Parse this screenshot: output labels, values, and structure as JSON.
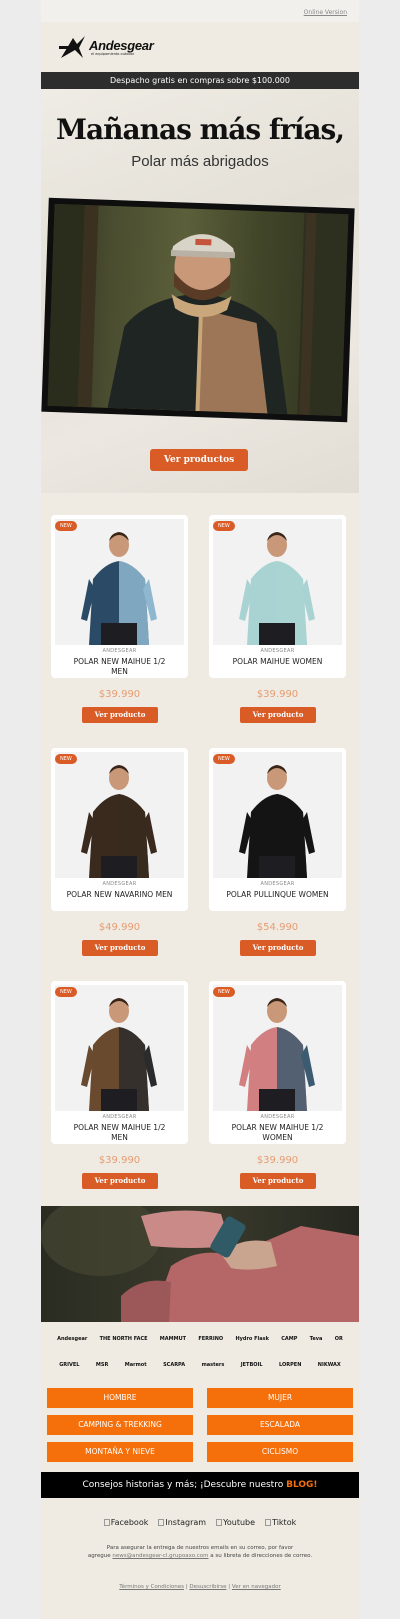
{
  "topbar": {
    "online_version": "Online Version"
  },
  "logo": {
    "name": "Andesgear",
    "tagline": "el equipamiento outdoor"
  },
  "shipping_banner": "Despacho gratis en compras sobre $100.000",
  "hero": {
    "title": "Mañanas más frías,",
    "subtitle": "Polar más abrigados",
    "cta": "Ver productos"
  },
  "products": [
    {
      "badge": "NEW",
      "brand": "ANDESGEAR",
      "name": "POLAR NEW MAIHUE 1/2 MEN",
      "price": "$39.990",
      "button": "Ver producto",
      "colors": {
        "body": "#2b4a66",
        "accent": "#8fb7d0"
      }
    },
    {
      "badge": "NEW",
      "brand": "ANDESGEAR",
      "name": "POLAR MAIHUE WOMEN",
      "price": "$39.990",
      "button": "Ver producto",
      "colors": {
        "body": "#a9d3d2",
        "accent": "#a9d3d2"
      }
    },
    {
      "badge": "NEW",
      "brand": "ANDESGEAR",
      "name": "POLAR NEW NAVARINO MEN",
      "price": "$49.990",
      "button": "Ver producto",
      "colors": {
        "body": "#3a2a1e",
        "accent": "#3a2a1e"
      }
    },
    {
      "badge": "NEW",
      "brand": "ANDESGEAR",
      "name": "POLAR PULLINQUE WOMEN",
      "price": "$54.990",
      "button": "Ver producto",
      "colors": {
        "body": "#141414",
        "accent": "#141414"
      }
    },
    {
      "badge": "NEW",
      "brand": "ANDESGEAR",
      "name": "POLAR NEW MAIHUE 1/2 MEN",
      "price": "$39.990",
      "button": "Ver producto",
      "colors": {
        "body": "#6a4a2e",
        "accent": "#2b2b2b"
      }
    },
    {
      "badge": "NEW",
      "brand": "ANDESGEAR",
      "name": "POLAR NEW MAIHUE 1/2 WOMEN",
      "price": "$39.990",
      "button": "Ver producto",
      "colors": {
        "body": "#d17f80",
        "accent": "#3c5a70"
      }
    }
  ],
  "brands_row1": [
    "Andesgear",
    "THE NORTH FACE",
    "MAMMUT",
    "FERRINO",
    "Hydro Flask",
    "CAMP",
    "Teva",
    "OR"
  ],
  "brands_row2": [
    "GRIVEL",
    "MSR",
    "Marmot",
    "SCARPA",
    "masters",
    "JETBOIL",
    "LORPEN",
    "NIKWAX"
  ],
  "categories": [
    [
      "HOMBRE",
      "MUJER"
    ],
    [
      "CAMPING & TREKKING",
      "ESCALADA"
    ],
    [
      "MONTAÑA Y NIEVE",
      "CICLISMO"
    ]
  ],
  "blog": {
    "text": "Consejos historias y más; ¡Descubre nuestro ",
    "highlight": "BLOG!"
  },
  "social": [
    "Facebook",
    "Instagram",
    "Youtube",
    "Tiktok"
  ],
  "footnote": {
    "line1": "Para asegurar la entrega de nuestros emails en su correo, por favor",
    "line2_pre": "agregue ",
    "email": "news@andesgear-cl.grupoaxo.com",
    "line2_post": " a su libreta de direcciones de correo."
  },
  "footer_links": [
    "Términos y Condiciones",
    "Desuscribirse",
    "Ver en navegador"
  ],
  "colors": {
    "accent": "#d95b26",
    "category": "#f56f0b",
    "price": "#e79c72"
  }
}
